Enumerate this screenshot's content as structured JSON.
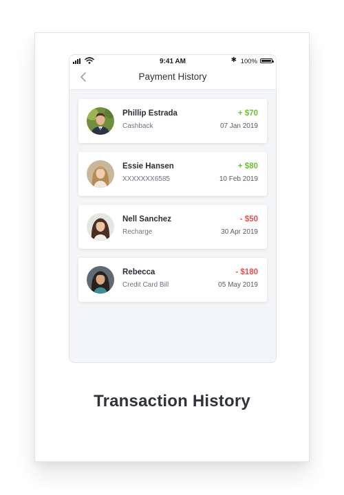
{
  "status_bar": {
    "time": "9:41 AM",
    "bluetooth": "✱",
    "battery": "100%"
  },
  "header": {
    "back_icon": "chevron-left-icon",
    "title": "Payment History"
  },
  "colors": {
    "credit": "#6cc12e",
    "debit": "#f04a4a"
  },
  "transactions": [
    {
      "name": "Phillip Estrada",
      "detail": "Cashback",
      "amount": "+ $70",
      "date": "07 Jan 2019",
      "type": "credit"
    },
    {
      "name": "Essie Hansen",
      "detail": "XXXXXXX6585",
      "amount": "+ $80",
      "date": "10 Feb 2019",
      "type": "credit"
    },
    {
      "name": "Nell Sanchez",
      "detail": "Recharge",
      "amount": "- $50",
      "date": "30 Apr 2019",
      "type": "debit"
    },
    {
      "name": "Rebecca",
      "detail": "Credit Card Bill",
      "amount": "- $180",
      "date": "05 May 2019",
      "type": "debit"
    }
  ],
  "caption": "Transaction History"
}
